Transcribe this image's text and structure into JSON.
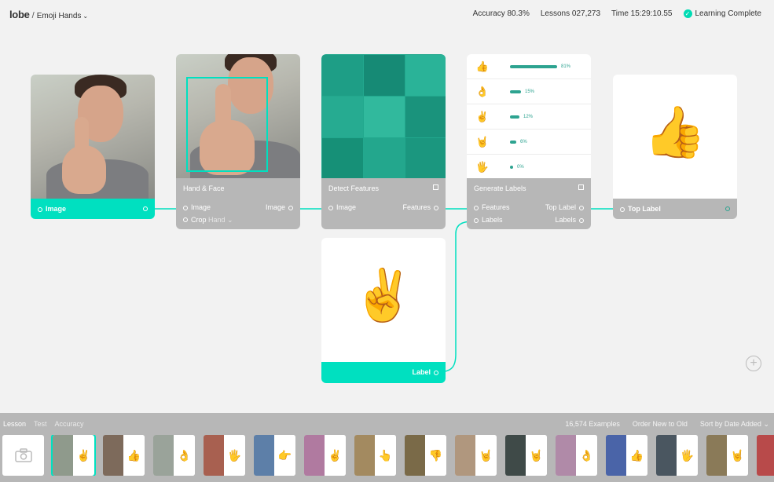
{
  "header": {
    "logo": "lobe",
    "separator": "/",
    "project": "Emoji Hands",
    "accuracy": "Accuracy 80.3%",
    "lessons": "Lessons 027,273",
    "time": "Time 15:29:10.55",
    "status": "Learning Complete",
    "accent_color": "#00e0c0"
  },
  "nodes": {
    "image": {
      "port": "Image"
    },
    "hand_face": {
      "title": "Hand & Face",
      "in_label": "Image",
      "out_label": "Image",
      "crop_label": "Crop",
      "crop_value": "Hand"
    },
    "detect": {
      "title": "Detect Features",
      "in_label": "Image",
      "out_label": "Features"
    },
    "generate": {
      "title": "Generate Labels",
      "in1": "Features",
      "in2": "Labels",
      "out1": "Top Label",
      "out2": "Labels",
      "predictions": [
        {
          "emoji": "👍",
          "pct": "81%",
          "value": 0.81
        },
        {
          "emoji": "👌",
          "pct": "15%",
          "value": 0.15
        },
        {
          "emoji": "✌️",
          "pct": "12%",
          "value": 0.12
        },
        {
          "emoji": "🤘",
          "pct": "6%",
          "value": 0.06
        },
        {
          "emoji": "🖐",
          "pct": "0%",
          "value": 0.0
        }
      ]
    },
    "top_label": {
      "port": "Top Label",
      "emoji": "👍"
    },
    "label": {
      "port": "Label",
      "emoji": "✌️"
    }
  },
  "bottom": {
    "tabs": [
      "Lesson",
      "Test",
      "Accuracy"
    ],
    "examples": "16,574 Examples",
    "order": "Order New to Old",
    "sort": "Sort by Date Added",
    "thumbnails": [
      {
        "emoji": "✌️",
        "selected": true
      },
      {
        "emoji": "👍"
      },
      {
        "emoji": "👌"
      },
      {
        "emoji": "🖐"
      },
      {
        "emoji": "👉"
      },
      {
        "emoji": "✌️"
      },
      {
        "emoji": "👆"
      },
      {
        "emoji": "👎"
      },
      {
        "emoji": "🤘"
      },
      {
        "emoji": "🤘"
      },
      {
        "emoji": "👌"
      },
      {
        "emoji": "👍"
      },
      {
        "emoji": "🖐"
      },
      {
        "emoji": "🤘"
      },
      {
        "emoji": "🤘"
      }
    ]
  }
}
